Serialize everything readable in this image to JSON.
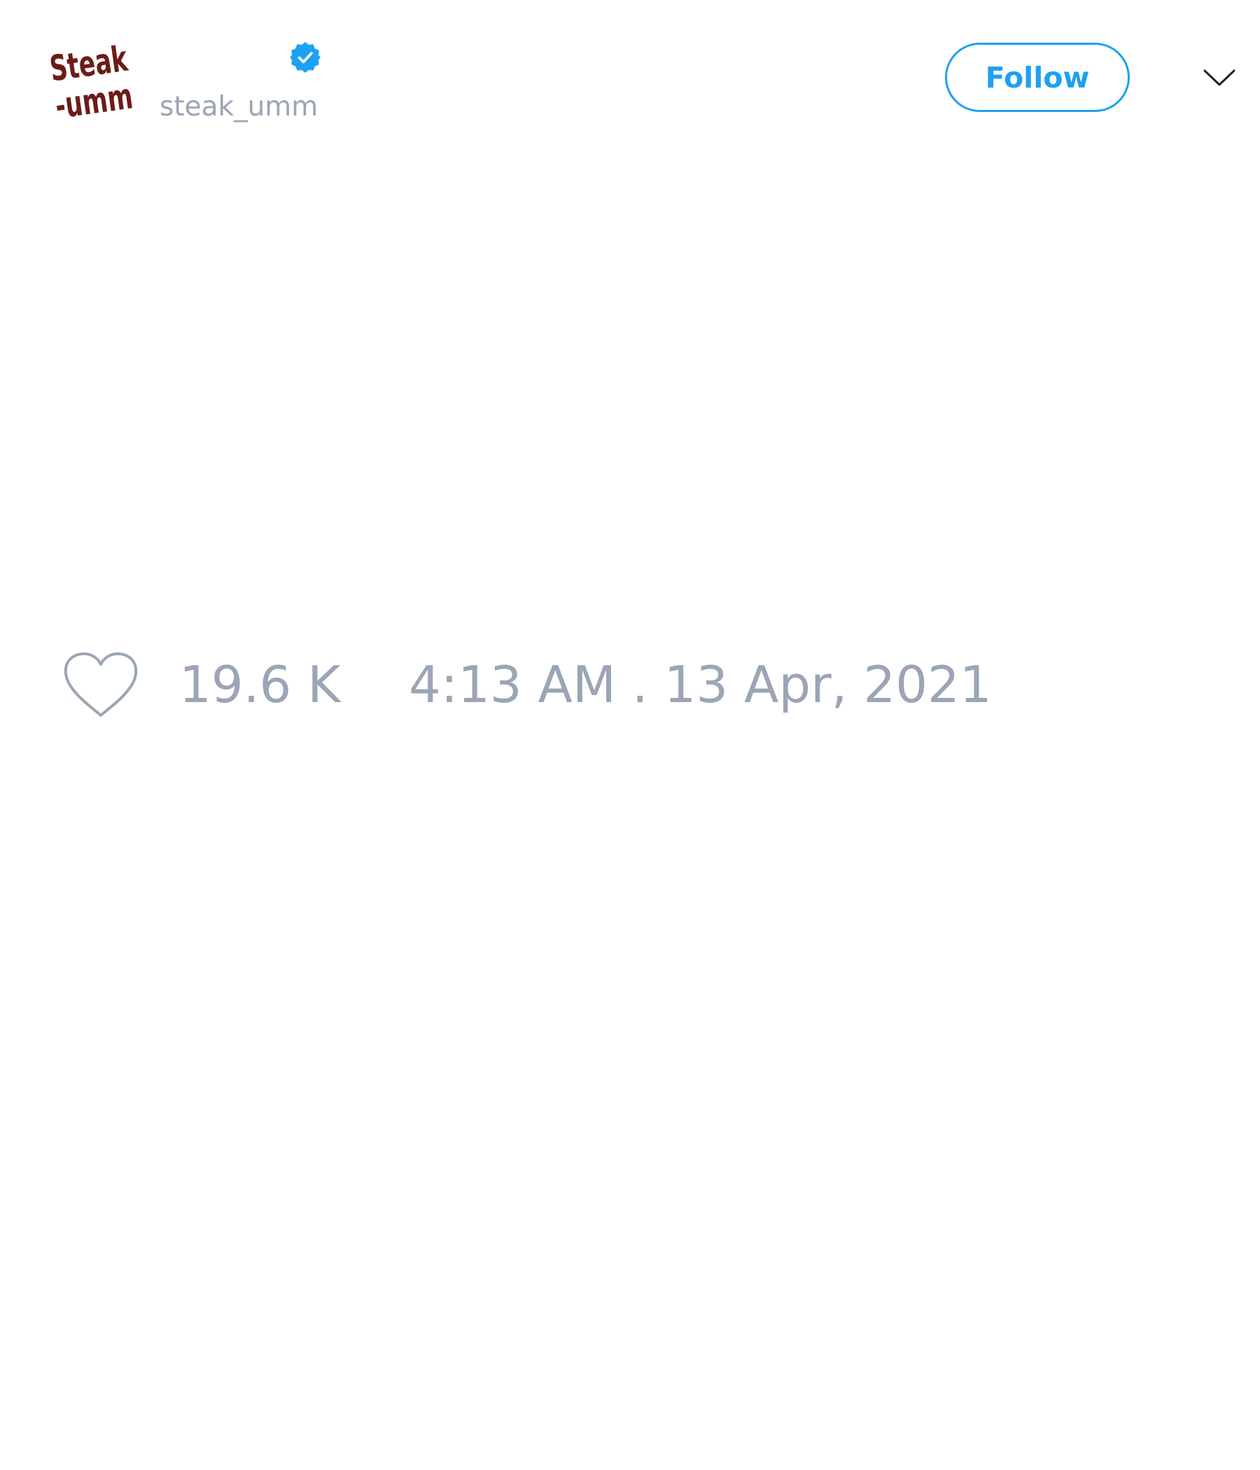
{
  "author": {
    "avatar_logo_text": [
      "Steak",
      "-umm"
    ],
    "handle": "steak_umm",
    "verified_icon": "verified-badge-icon"
  },
  "header": {
    "follow_label": "Follow",
    "menu_icon": "chevron-down-icon"
  },
  "tweet": {
    "like_icon": "heart-icon",
    "like_count": "19.6 K",
    "timestamp": "4:13 AM . 13 Apr, 2021"
  },
  "colors": {
    "accent": "#1da1f2",
    "muted_text": "#9aa5b5",
    "logo_red": "#7a1f1a",
    "background": "#ffffff"
  }
}
